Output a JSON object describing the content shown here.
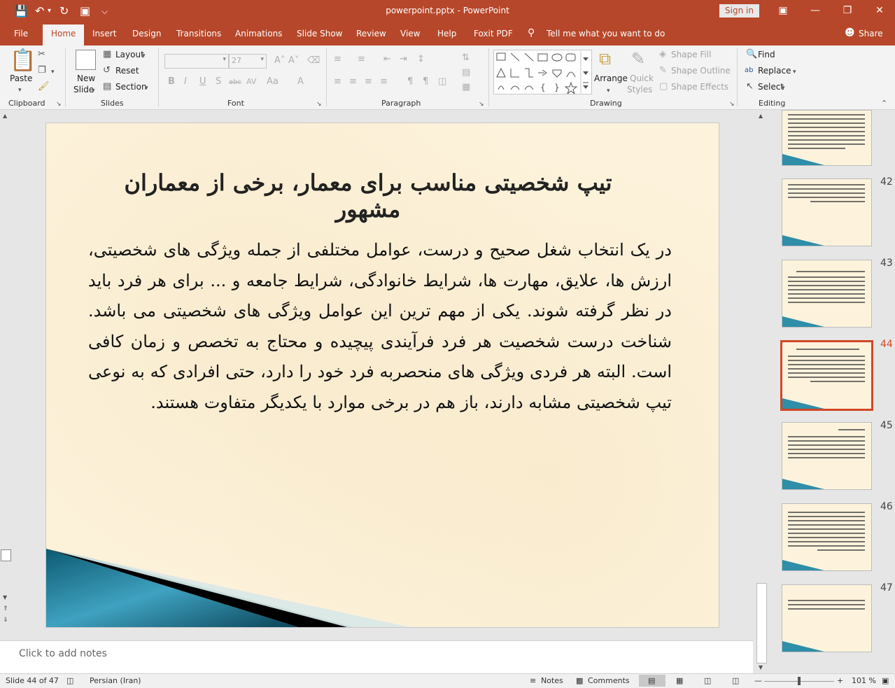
{
  "app": {
    "doc_title": "powerpoint.pptx  -  PowerPoint",
    "signin": "Sign in"
  },
  "tabs": [
    "File",
    "Home",
    "Insert",
    "Design",
    "Transitions",
    "Animations",
    "Slide Show",
    "Review",
    "View",
    "Help",
    "Foxit PDF"
  ],
  "tell_me": "Tell me what you want to do",
  "share": "Share",
  "ribbon": {
    "clipboard": {
      "label": "Clipboard",
      "paste": "Paste"
    },
    "slides": {
      "label": "Slides",
      "new_slide_1": "New",
      "new_slide_2": "Slide",
      "layout": "Layout",
      "reset": "Reset",
      "section": "Section"
    },
    "font": {
      "label": "Font",
      "font_name": "",
      "font_size": "27"
    },
    "paragraph": {
      "label": "Paragraph"
    },
    "drawing": {
      "label": "Drawing",
      "arrange": "Arrange",
      "quick_styles_1": "Quick",
      "quick_styles_2": "Styles",
      "shape_fill": "Shape Fill",
      "shape_outline": "Shape Outline",
      "shape_effects": "Shape Effects"
    },
    "editing": {
      "label": "Editing",
      "find": "Find",
      "replace": "Replace",
      "select": "Select"
    }
  },
  "slide": {
    "title": "تیپ شخصیتی مناسب برای معمار، برخی از معماران مشهور",
    "body": "در یک انتخاب شغل صحیح و درست، عوامل مختلفی از جمله ویژگی های شخصیتی، ارزش ها، علایق، مهارت ها، شرایط خانوادگی، شرایط جامعه و ... برای هر فرد باید در نظر گرفته شوند. یکی از مهم ترین این عوامل ویژگی های شخصیتی می باشد. شناخت درست شخصیت هر فرد فرآیندی پیچیده و محتاج به تخصص و زمان کافی است. البته هر فردی ویژگی های منحصربه فرد خود را دارد، حتی افرادی که به نوعی تیپ شخصیتی مشابه دارند، باز هم در برخی موارد با یکدیگر متفاوت هستند."
  },
  "notes_placeholder": "Click to add notes",
  "thumbnails": [
    {
      "num": "",
      "active": false
    },
    {
      "num": "42",
      "active": false
    },
    {
      "num": "43",
      "active": false
    },
    {
      "num": "44",
      "active": true
    },
    {
      "num": "45",
      "active": false
    },
    {
      "num": "46",
      "active": false
    },
    {
      "num": "47",
      "active": false
    }
  ],
  "status": {
    "slide_info": "Slide 44 of 47",
    "language": "Persian (Iran)",
    "notes": "Notes",
    "comments": "Comments",
    "zoom": "101 %"
  },
  "colors": {
    "accent": "#b7472a",
    "active_thumb": "#d24726"
  }
}
